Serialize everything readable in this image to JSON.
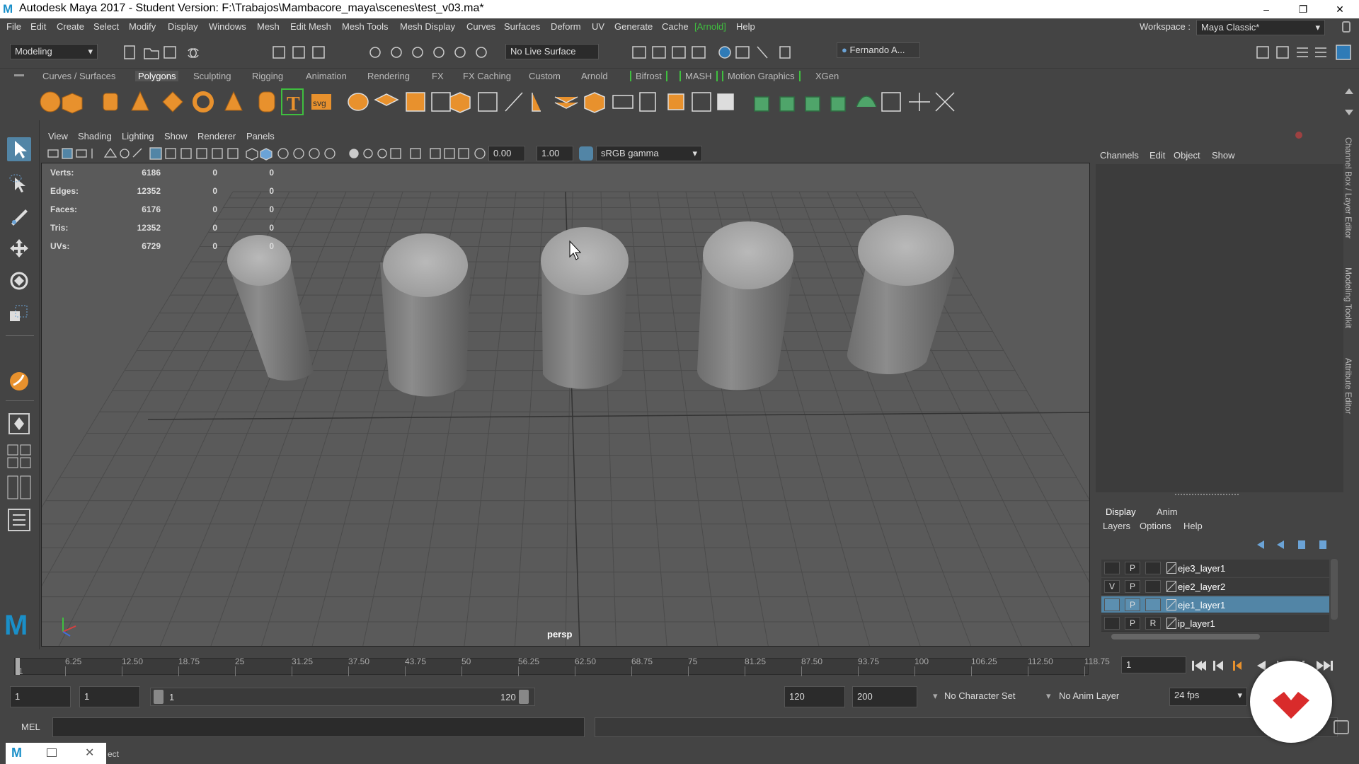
{
  "window": {
    "title": "Autodesk Maya 2017 - Student Version: F:\\Trabajos\\Mambacore_maya\\scenes\\test_v03.ma*",
    "minimize": "–",
    "restore": "❐",
    "close": "✕"
  },
  "menubar": {
    "items": [
      "File",
      "Edit",
      "Create",
      "Select",
      "Modify",
      "Display",
      "Windows",
      "Mesh",
      "Edit Mesh",
      "Mesh Tools",
      "Mesh Display",
      "Curves",
      "Surfaces",
      "Deform",
      "UV",
      "Generate",
      "Cache",
      "[Arnold]",
      "Help"
    ],
    "workspace_label": "Workspace :",
    "workspace_value": "Maya Classic*"
  },
  "statusline": {
    "mode": "Modeling",
    "live_surface": "No Live Surface",
    "user": "Fernando A..."
  },
  "shelf_tabs": [
    "Curves / Surfaces",
    "Polygons",
    "Sculpting",
    "Rigging",
    "Animation",
    "Rendering",
    "FX",
    "FX Caching",
    "Custom",
    "Arnold",
    "Bifrost",
    "MASH",
    "Motion Graphics",
    "XGen"
  ],
  "shelf_active": "Polygons",
  "viewport": {
    "menu": [
      "View",
      "Shading",
      "Lighting",
      "Show",
      "Renderer",
      "Panels"
    ],
    "exposure": "0.00",
    "gamma": "1.00",
    "colorspace": "sRGB gamma",
    "camera": "persp",
    "hud": [
      {
        "label": "Verts:",
        "v1": "6186",
        "v2": "0",
        "v3": "0"
      },
      {
        "label": "Edges:",
        "v1": "12352",
        "v2": "0",
        "v3": "0"
      },
      {
        "label": "Faces:",
        "v1": "6176",
        "v2": "0",
        "v3": "0"
      },
      {
        "label": "Tris:",
        "v1": "12352",
        "v2": "0",
        "v3": "0"
      },
      {
        "label": "UVs:",
        "v1": "6729",
        "v2": "0",
        "v3": "0"
      }
    ]
  },
  "channelbox": {
    "menu": [
      "Channels",
      "Edit",
      "Object",
      "Show"
    ]
  },
  "side_tabs": [
    "Channel Box / Layer Editor",
    "Modeling Toolkit",
    "Attribute Editor"
  ],
  "layer_editor": {
    "tabs": [
      "Display",
      "Anim"
    ],
    "menu": [
      "Layers",
      "Options",
      "Help"
    ],
    "layers": [
      {
        "v": "",
        "p": "P",
        "r": "",
        "name": "eje3_layer1",
        "selected": false
      },
      {
        "v": "V",
        "p": "P",
        "r": "",
        "name": "eje2_layer2",
        "selected": false
      },
      {
        "v": "",
        "p": "P",
        "r": "",
        "name": "eje1_layer1",
        "selected": true
      },
      {
        "v": "",
        "p": "P",
        "r": "R",
        "name": "ip_layer1",
        "selected": false
      }
    ]
  },
  "timeline": {
    "ticks": [
      "1",
      "6.25",
      "12.50",
      "18.75",
      "25",
      "31.25",
      "37.50",
      "43.75",
      "50",
      "56.25",
      "62.50",
      "68.75",
      "75",
      "81.25",
      "87.50",
      "93.75",
      "100",
      "106.25",
      "112.50",
      "118.75"
    ],
    "current_frame": "1"
  },
  "range": {
    "start": "1",
    "playback_start": "1",
    "slider_start": "1",
    "slider_end": "120",
    "playback_end": "120",
    "end": "200",
    "character_set": "No Character Set",
    "anim_layer": "No Anim Layer",
    "fps": "24 fps"
  },
  "cmdline": {
    "label": "MEL"
  },
  "helpline": {
    "text": "ect"
  },
  "colors": {
    "accent": "#5285a6",
    "arnold_green": "#3fbf3f",
    "shelf_orange": "#e8912d"
  }
}
